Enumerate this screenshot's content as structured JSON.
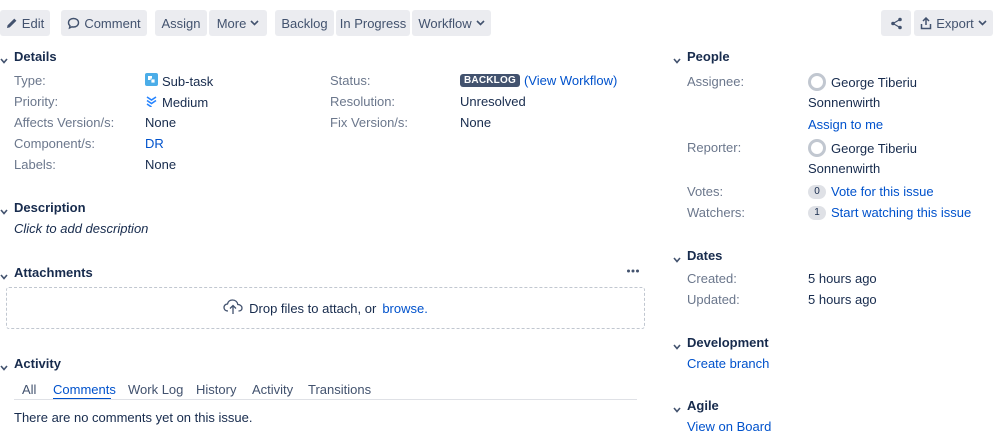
{
  "toolbar": {
    "edit": "Edit",
    "comment": "Comment",
    "assign": "Assign",
    "more": "More",
    "backlog": "Backlog",
    "in_progress": "In Progress",
    "workflow": "Workflow",
    "export": "Export"
  },
  "details": {
    "title": "Details",
    "type_label": "Type:",
    "type_value": "Sub-task",
    "priority_label": "Priority:",
    "priority_value": "Medium",
    "affects_label": "Affects Version/s:",
    "affects_value": "None",
    "component_label": "Component/s:",
    "component_value": "DR",
    "labels_label": "Labels:",
    "labels_value": "None",
    "status_label": "Status:",
    "status_value": "BACKLOG",
    "view_workflow": "(View Workflow)",
    "resolution_label": "Resolution:",
    "resolution_value": "Unresolved",
    "fix_label": "Fix Version/s:",
    "fix_value": "None"
  },
  "description": {
    "title": "Description",
    "placeholder": "Click to add description"
  },
  "attachments": {
    "title": "Attachments",
    "drop_text": "Drop files to attach, or",
    "browse": "browse."
  },
  "activity": {
    "title": "Activity",
    "tabs": [
      "All",
      "Comments",
      "Work Log",
      "History",
      "Activity",
      "Transitions"
    ],
    "active_tab": "Comments",
    "empty": "There are no comments yet on this issue."
  },
  "people": {
    "title": "People",
    "assignee_label": "Assignee:",
    "assignee_name1": "George Tiberiu",
    "assignee_name2": "Sonnenwirth",
    "assign_to_me": "Assign to me",
    "reporter_label": "Reporter:",
    "reporter_name1": "George Tiberiu",
    "reporter_name2": "Sonnenwirth",
    "votes_label": "Votes:",
    "votes_count": "0",
    "vote_link": "Vote for this issue",
    "watchers_label": "Watchers:",
    "watchers_count": "1",
    "watch_link": "Start watching this issue"
  },
  "dates": {
    "title": "Dates",
    "created_label": "Created:",
    "created_value": "5 hours ago",
    "updated_label": "Updated:",
    "updated_value": "5 hours ago"
  },
  "development": {
    "title": "Development",
    "create_branch": "Create branch"
  },
  "agile": {
    "title": "Agile",
    "view_on_board": "View on Board"
  },
  "colors": {
    "link": "#0052cc",
    "button_bg": "#ebecf0",
    "status_lozenge": "#42526e"
  }
}
